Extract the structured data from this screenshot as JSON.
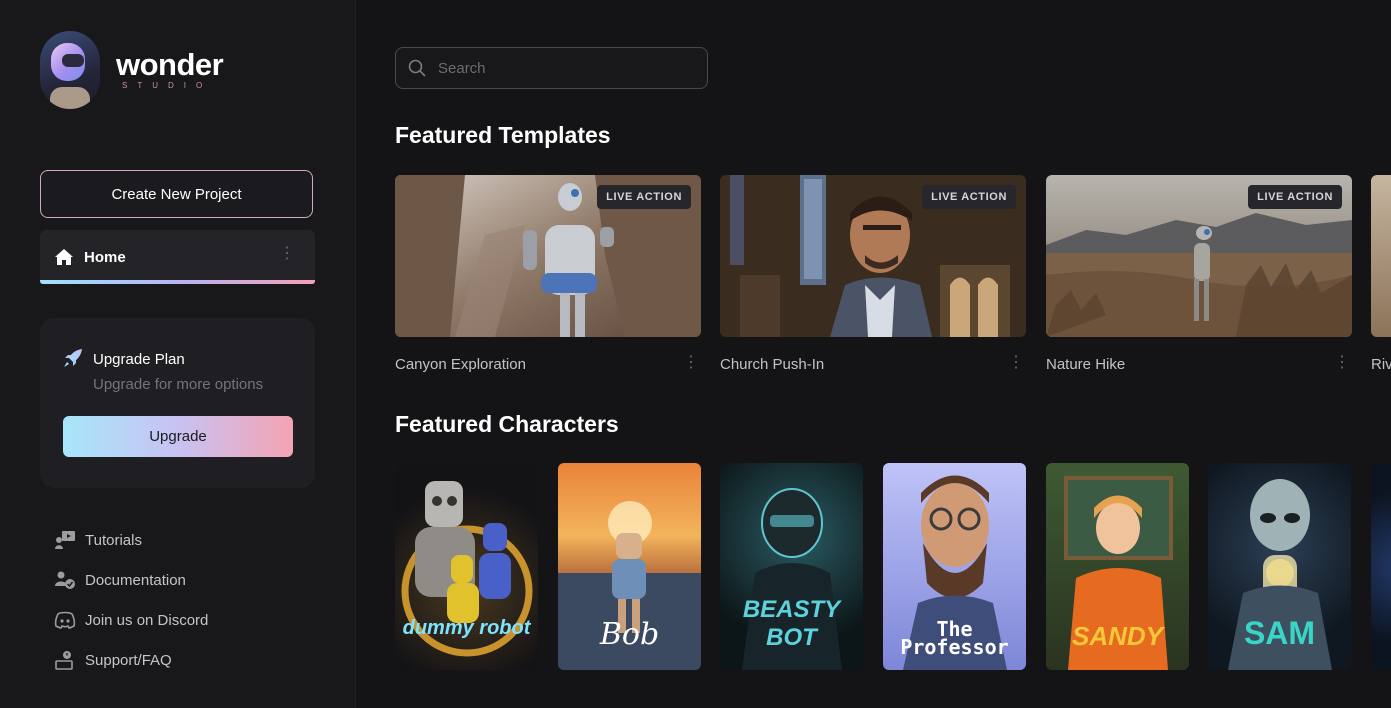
{
  "brand": {
    "name": "wonder",
    "subtitle": "STUDIO"
  },
  "sidebar": {
    "create_label": "Create New Project",
    "home_label": "Home",
    "upgrade": {
      "title": "Upgrade Plan",
      "subtitle": "Upgrade for more options",
      "button": "Upgrade"
    },
    "links": [
      {
        "label": "Tutorials",
        "icon": "video-tutorial-icon"
      },
      {
        "label": "Documentation",
        "icon": "documentation-icon"
      },
      {
        "label": "Join us on Discord",
        "icon": "discord-icon"
      },
      {
        "label": "Support/FAQ",
        "icon": "support-icon"
      }
    ]
  },
  "search": {
    "placeholder": "Search"
  },
  "templates": {
    "title": "Featured Templates",
    "items": [
      {
        "name": "Canyon Exploration",
        "badge": "LIVE ACTION"
      },
      {
        "name": "Church Push-In",
        "badge": "LIVE ACTION"
      },
      {
        "name": "Nature Hike",
        "badge": "LIVE ACTION"
      },
      {
        "name": "Riv"
      }
    ]
  },
  "characters": {
    "title": "Featured Characters",
    "items": [
      {
        "name": "dummy robot"
      },
      {
        "name": "Bob"
      },
      {
        "name": "BEASTY BOT"
      },
      {
        "name": "The Professor"
      },
      {
        "name": "SANDY"
      },
      {
        "name": "SAM"
      }
    ]
  },
  "colors": {
    "accent_start": "#a8e6fa",
    "accent_mid": "#c8c2f2",
    "accent_end": "#f4a3b3",
    "background": "#141316",
    "sidebar": "#18171a"
  }
}
